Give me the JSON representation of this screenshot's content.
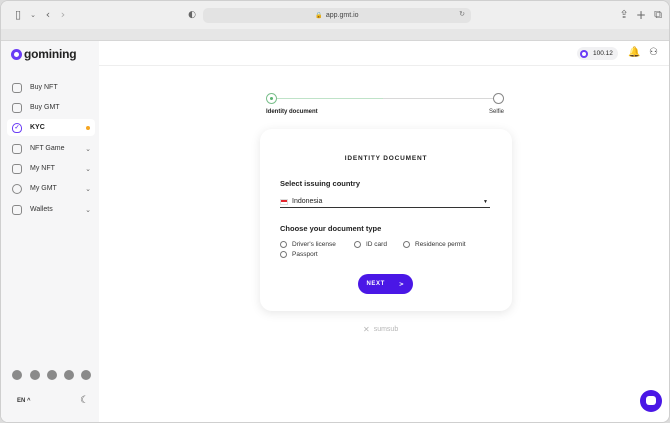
{
  "browser": {
    "url": "app.gmt.io"
  },
  "sidebar": {
    "logo_text": "gomining",
    "items": [
      {
        "label": "Buy NFT"
      },
      {
        "label": "Buy GMT"
      },
      {
        "label": "KYC"
      },
      {
        "label": "NFT Game"
      },
      {
        "label": "My NFT"
      },
      {
        "label": "My GMT"
      },
      {
        "label": "Wallets"
      }
    ],
    "language": "EN ^"
  },
  "header": {
    "balance": "100.12"
  },
  "stepper": {
    "steps": [
      {
        "label": "Identity document"
      },
      {
        "label": "Selfie"
      }
    ]
  },
  "card": {
    "title": "IDENTITY DOCUMENT",
    "country_label": "Select issuing country",
    "country_value": "Indonesia",
    "doc_type_label": "Choose your document type",
    "options": [
      {
        "label": "Driver's license"
      },
      {
        "label": "ID card"
      },
      {
        "label": "Residence permit"
      },
      {
        "label": "Passport"
      }
    ],
    "next_label": "NEXT",
    "next_arrow": ">"
  },
  "footer": {
    "powered_by": "sumsub"
  },
  "colors": {
    "accent": "#4a17e6",
    "brand": "#6a3cf5",
    "step_done": "#5ab270"
  }
}
